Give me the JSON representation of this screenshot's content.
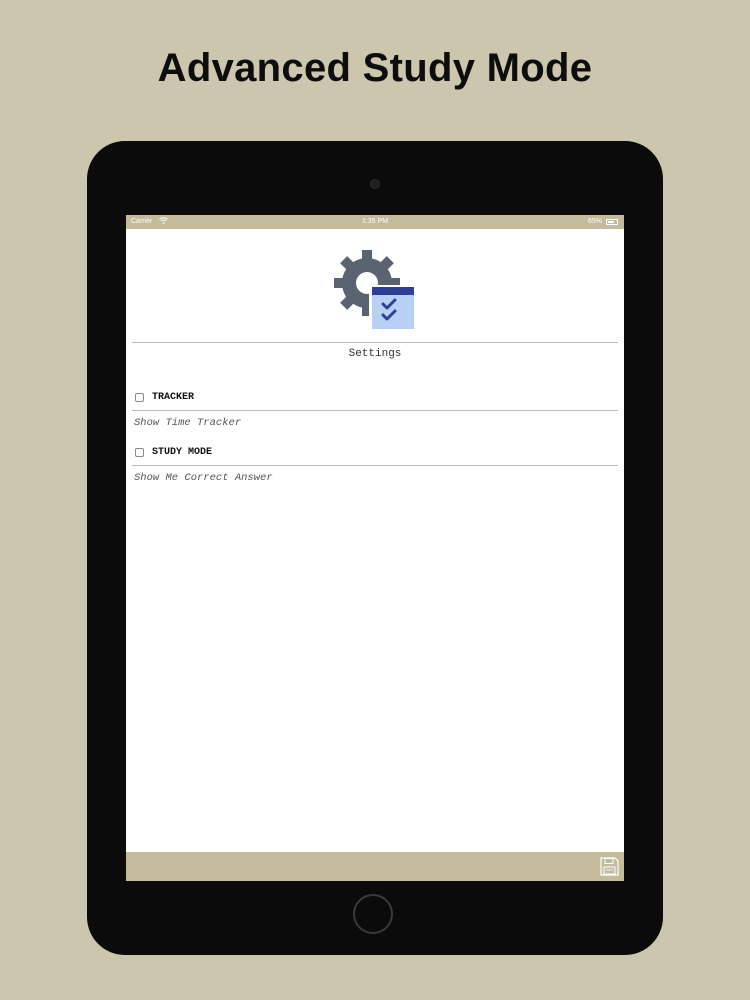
{
  "headline": "Advanced Study Mode",
  "status_bar": {
    "carrier": "Carrier",
    "time": "1:35 PM",
    "battery": "65%"
  },
  "settings_title": "Settings",
  "options": [
    {
      "label": "TRACKER",
      "description": "Show Time Tracker",
      "checked": false
    },
    {
      "label": "STUDY MODE",
      "description": "Show Me Correct Answer",
      "checked": false
    }
  ],
  "colors": {
    "background": "#cdc6ae",
    "bar": "#c3bb9b",
    "device": "#0b0b0b",
    "gear": "#5a6470",
    "calendar_header": "#2f3f96",
    "calendar_body": "#b7d0f3"
  },
  "icons": {
    "hero": "settings-gear-calendar-icon",
    "wifi": "wifi-icon",
    "battery": "battery-icon",
    "save": "floppy-disk-icon"
  }
}
